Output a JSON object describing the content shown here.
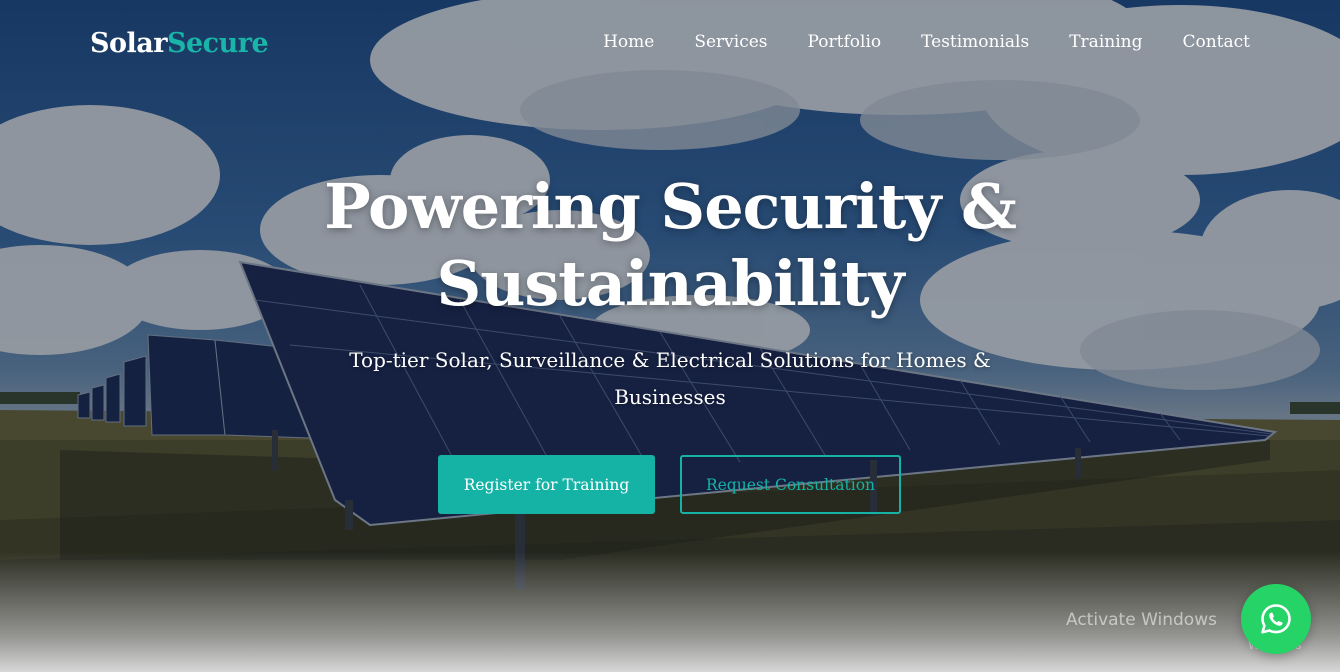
{
  "brand": {
    "part1": "Solar",
    "part2": "Secure"
  },
  "nav": {
    "items": [
      {
        "label": "Home"
      },
      {
        "label": "Services"
      },
      {
        "label": "Portfolio"
      },
      {
        "label": "Testimonials"
      },
      {
        "label": "Training"
      },
      {
        "label": "Contact"
      }
    ]
  },
  "hero": {
    "title_line1": "Powering Security &",
    "title_line2": "Sustainability",
    "subtitle_line1": "Top-tier Solar, Surveillance & Electrical Solutions for Homes &",
    "subtitle_line2": "Businesses",
    "primary_button": "Register for Training",
    "secondary_button": "Request Consultation"
  },
  "watermark": {
    "text": "Activate Windows",
    "sub": "Windows"
  },
  "icons": {
    "floating": "whatsapp-icon"
  },
  "colors": {
    "accent": "#14b3a6",
    "whatsapp": "#25d366",
    "text": "#ffffff"
  }
}
